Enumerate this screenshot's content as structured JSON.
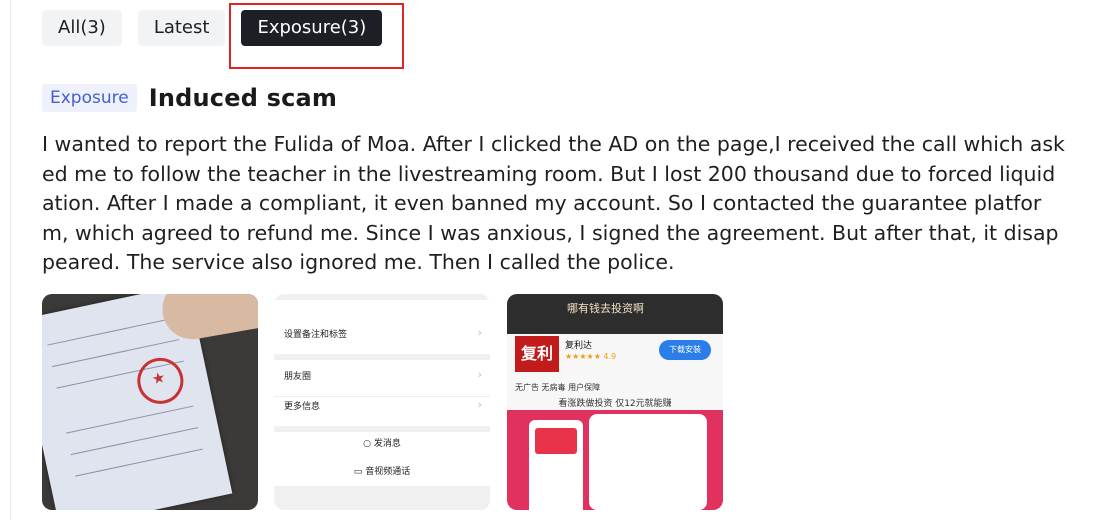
{
  "tabs": [
    {
      "label": "All(3)",
      "active": false
    },
    {
      "label": "Latest",
      "active": false
    },
    {
      "label": "Exposure(3)",
      "active": true
    }
  ],
  "post": {
    "tag": "Exposure",
    "title": "Induced scam",
    "body": "I wanted to report the Fulida of Moa. After I clicked the AD on the page,I received the call which asked me to follow the teacher in the livestreaming room. But I lost 200 thousand due to forced liquidation. After I made a compliant, it even banned my account. So I contacted the guarantee platform, which agreed to refund me. Since I was anxious, I signed the agreement. But after that, it disappeared. The service also ignored me. Then I called the police."
  },
  "images": {
    "chat_settings": {
      "rows": [
        "设置备注和标签",
        "朋友圈",
        "更多信息"
      ],
      "actions": [
        "发消息",
        "音视频通话"
      ]
    },
    "app_ad": {
      "banner": "哪有钱去投资啊",
      "icon_text": "复利",
      "app_name": "复利达",
      "rating": "★★★★★ 4.9",
      "download": "下载安装",
      "badges": "无广告   无病毒   用户保障",
      "slogan": "看涨跌做投资 仅12元就能赚"
    }
  },
  "colors": {
    "active_tab_bg": "#1c1f26",
    "tag_bg": "#eef1fb",
    "tag_text": "#4360c9",
    "highlight": "#e02424"
  }
}
